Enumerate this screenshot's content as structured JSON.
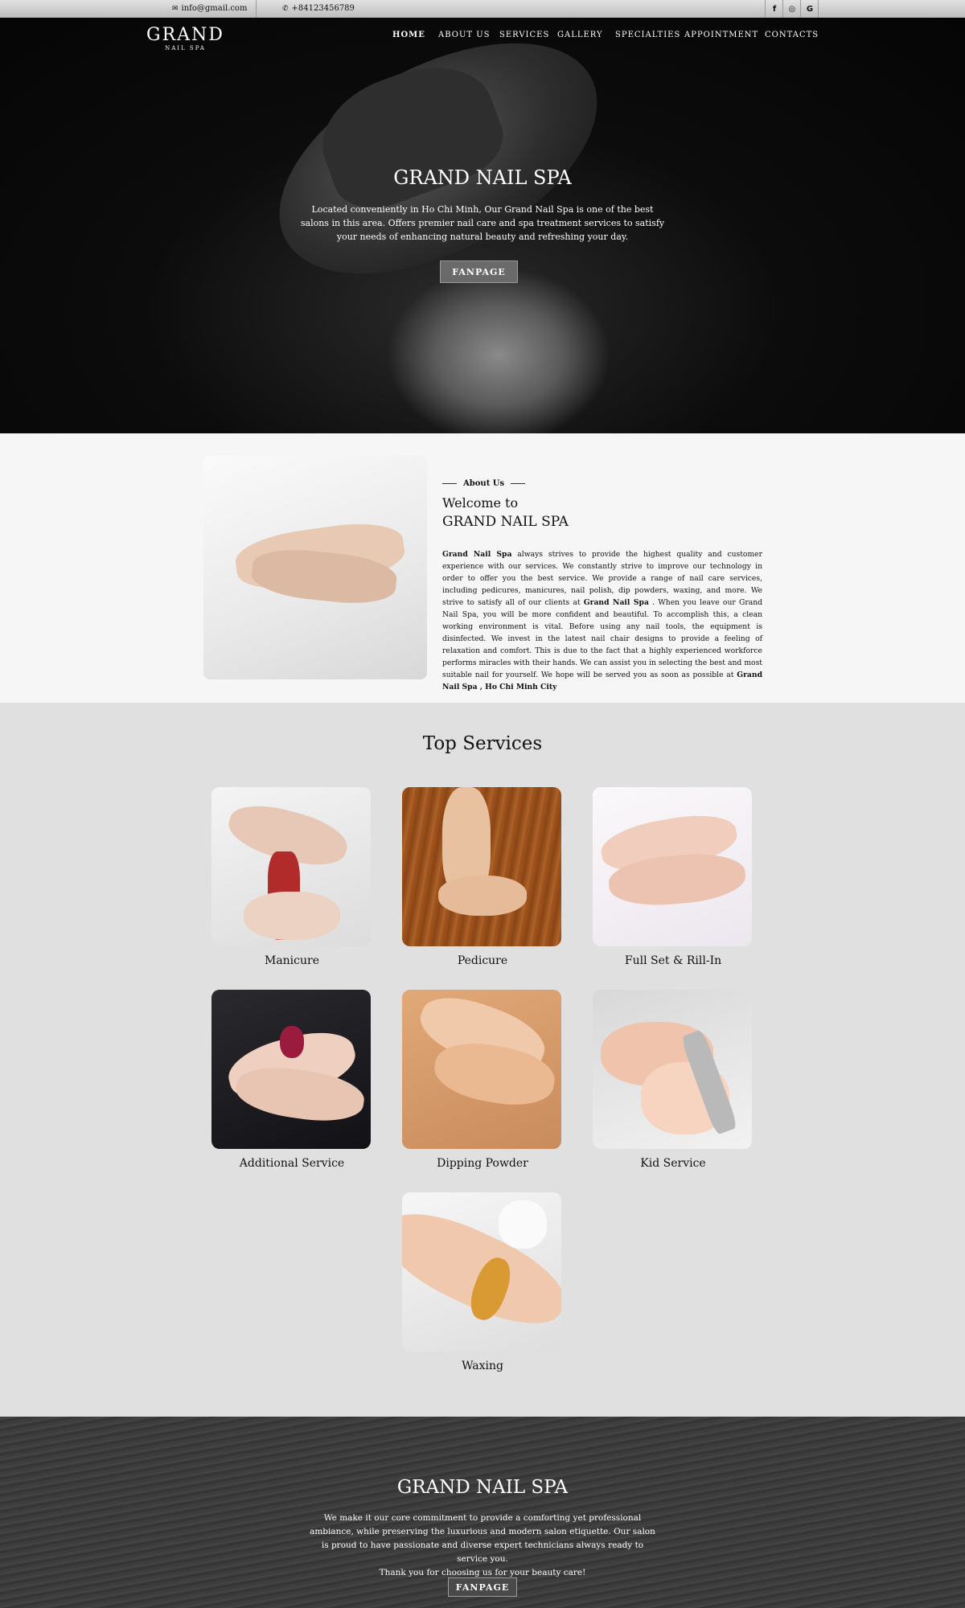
{
  "topbar": {
    "email": "info@gmail.com",
    "phone": "+84123456789",
    "social": [
      "f",
      "◎",
      "G"
    ]
  },
  "logo": {
    "line1": "GRAND",
    "line2": "NAIL SPA"
  },
  "nav": [
    "HOME",
    "ABOUT US",
    "SERVICES",
    "GALLERY",
    "SPECIALTIES",
    "APPOINTMENT",
    "CONTACTS"
  ],
  "hero": {
    "title": "GRAND NAIL SPA",
    "text": "Located conveniently in Ho Chi Minh, Our Grand Nail Spa is one of the best salons in this area. Offers premier nail care and spa treatment services to satisfy your needs of enhancing natural beauty and refreshing your day.",
    "button": "FANPAGE"
  },
  "about": {
    "tag": "About Us",
    "heading1": "Welcome to",
    "heading2": "GRAND NAIL SPA",
    "bold1": "Grand Nail Spa",
    "text1": " always strives to provide the highest quality and customer experience with our services. We constantly strive to improve our technology in order to offer you the best service. We provide a range of nail care services, including pedicures, manicures, nail polish, dip powders, waxing, and more. We strive to satisfy all of our clients at ",
    "bold2": "Grand Nail Spa",
    "text2": " . When you leave our Grand Nail Spa, you will be more confident and beautiful. To accomplish this, a clean working environment is vital. Before using any nail tools, the equipment is disinfected. We invest in the latest nail chair designs to provide a feeling of relaxation and comfort. This is due to the fact that a highly experienced workforce performs miracles with their hands. We can assist you in selecting the best and most suitable nail for yourself. We hope will be served you as soon as possible at ",
    "bold3": "Grand Nail Spa , Ho Chi Minh City"
  },
  "services": {
    "title": "Top Services",
    "items": [
      "Manicure",
      "Pedicure",
      "Full Set & Rill-In",
      "Additional Service",
      "Dipping Powder",
      "Kid Service",
      "Waxing"
    ]
  },
  "footer": {
    "title": "GRAND NAIL SPA",
    "line1": "We make it our core commitment to provide a comforting yet professional ambiance, while preserving the luxurious and modern salon etiquette. Our salon is proud to have passionate and diverse expert technicians always ready to service you.",
    "line2": "Thank you for choosing us for your beauty care!",
    "button": "FANPAGE"
  }
}
